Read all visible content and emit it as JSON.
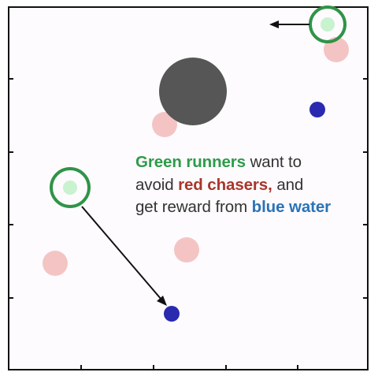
{
  "scene": {
    "colors": {
      "runner_ring": "#2f9447",
      "runner_fill": "#c9f2cf",
      "chaser": "#f4c4c4",
      "water": "#2a2ab0",
      "obstacle": "#565656",
      "arrow": "#111111",
      "frame": "#111111"
    },
    "entities": [
      {
        "type": "obstacle"
      },
      {
        "type": "runner"
      },
      {
        "type": "runner"
      },
      {
        "type": "chaser"
      },
      {
        "type": "chaser"
      },
      {
        "type": "chaser"
      },
      {
        "type": "chaser"
      },
      {
        "type": "water"
      },
      {
        "type": "water"
      }
    ]
  },
  "caption": {
    "line1_highlight": "Green runners",
    "line1_rest": " want to",
    "line2_start": "avoid ",
    "line2_highlight": "red chasers,",
    "line2_rest": " and",
    "line3_start": "get reward from ",
    "line3_highlight": "blue water"
  }
}
